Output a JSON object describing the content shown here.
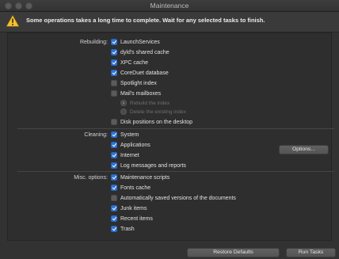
{
  "window": {
    "title": "Maintenance"
  },
  "warning": {
    "text": "Some operations takes a long time to complete. Wait for any selected tasks to finish."
  },
  "sections": {
    "rebuilding": {
      "label": "Rebuilding:",
      "items": [
        {
          "label": "LaunchServices",
          "checked": true
        },
        {
          "label": "dyld's shared cache",
          "checked": true
        },
        {
          "label": "XPC cache",
          "checked": true
        },
        {
          "label": "CoreDuet database",
          "checked": true
        },
        {
          "label": "Spotlight index",
          "checked": false
        },
        {
          "label": "Mail's mailboxes",
          "checked": false
        },
        {
          "label": "Disk positions on the desktop",
          "checked": false
        }
      ],
      "mail_options": [
        {
          "label": "Rebuild the index",
          "selected": true
        },
        {
          "label": "Delete the existing index",
          "selected": false
        }
      ]
    },
    "cleaning": {
      "label": "Cleaning:",
      "items": [
        {
          "label": "System",
          "checked": true
        },
        {
          "label": "Applications",
          "checked": true
        },
        {
          "label": "Internet",
          "checked": true
        },
        {
          "label": "Log messages and reports",
          "checked": true
        }
      ],
      "options_button": "Options..."
    },
    "misc": {
      "label": "Misc. options:",
      "items": [
        {
          "label": "Maintenance scripts",
          "checked": true
        },
        {
          "label": "Fonts cache",
          "checked": true
        },
        {
          "label": "Automatically saved versions of the documents",
          "checked": false
        },
        {
          "label": "Junk items",
          "checked": true
        },
        {
          "label": "Recent items",
          "checked": true
        },
        {
          "label": "Trash",
          "checked": true
        }
      ]
    }
  },
  "footer": {
    "restore_defaults": "Restore Defaults",
    "run_tasks": "Run Tasks"
  },
  "colors": {
    "accent": "#2f74d6",
    "background": "#323232"
  }
}
